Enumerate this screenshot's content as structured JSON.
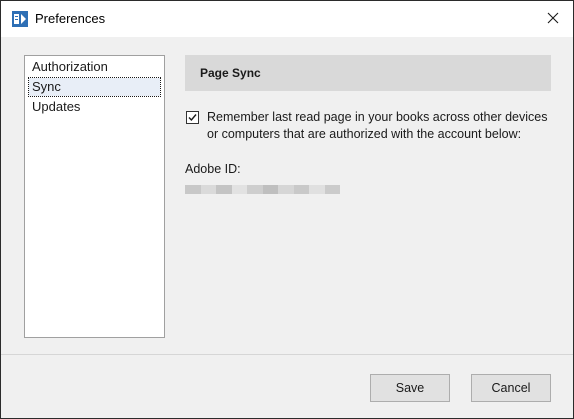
{
  "window": {
    "title": "Preferences",
    "app_icon": "app-logo-icon",
    "close_icon": "close-icon"
  },
  "categories": [
    {
      "label": "Authorization",
      "selected": false
    },
    {
      "label": "Sync",
      "selected": true
    },
    {
      "label": "Updates",
      "selected": false
    }
  ],
  "sync_panel": {
    "header": "Page Sync",
    "remember_checkbox": {
      "checked": true,
      "label": "Remember last read page in your books across other devices or computers that are authorized with the account below:"
    },
    "adobe_id_label": "Adobe ID:"
  },
  "buttons": {
    "save": "Save",
    "cancel": "Cancel"
  },
  "colors": {
    "header_bg": "#d9d9d9",
    "dialog_bg": "#f0f0f0",
    "selection_bg": "#e8eef7"
  }
}
